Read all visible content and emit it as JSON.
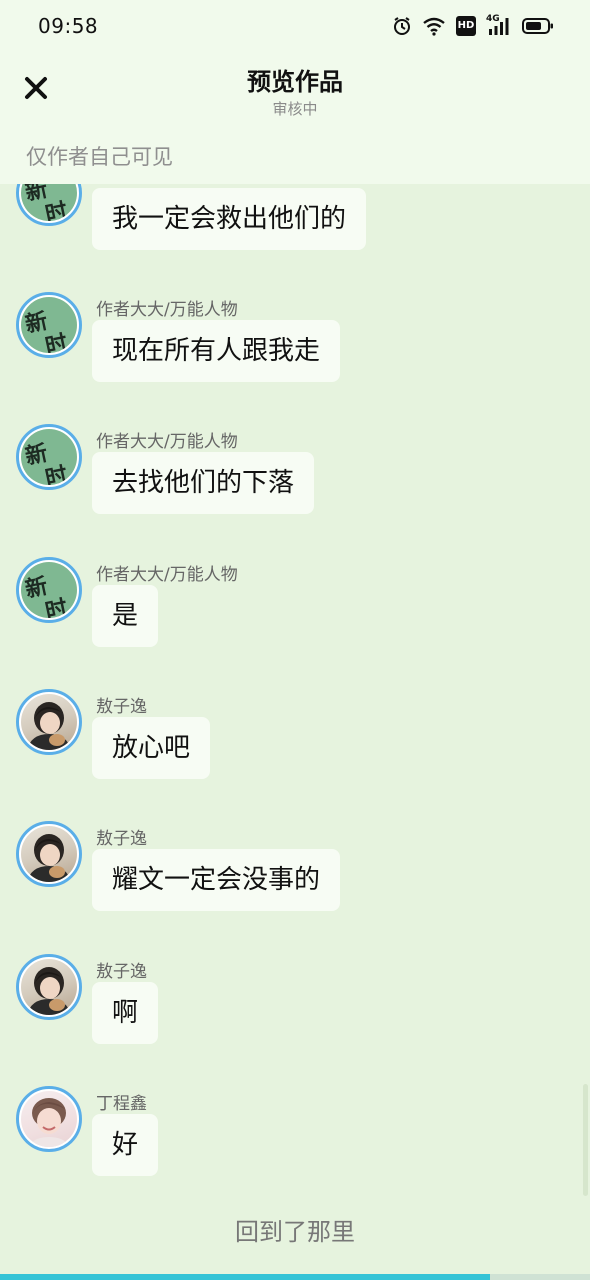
{
  "status_bar": {
    "time": "09:58",
    "icons": [
      "alarm-icon",
      "wifi-icon",
      "hd-icon",
      "signal-4g-icon",
      "battery-icon"
    ],
    "network_label": "4G",
    "hd_label": "HD"
  },
  "nav": {
    "close_icon": "close-icon",
    "title": "预览作品",
    "subtitle": "审核中"
  },
  "visibility_note": "仅作者自己可见",
  "avatar_glyphs": {
    "xinzu_line1": "新",
    "xinzu_line2": "时"
  },
  "messages": [
    {
      "sender": "",
      "avatar": "xinzu",
      "text": "我一定会救出他们的"
    },
    {
      "sender": "作者大大/万能人物",
      "avatar": "xinzu",
      "text": "现在所有人跟我走"
    },
    {
      "sender": "作者大大/万能人物",
      "avatar": "xinzu",
      "text": "去找他们的下落"
    },
    {
      "sender": "作者大大/万能人物",
      "avatar": "xinzu",
      "text": "是"
    },
    {
      "sender": "敖子逸",
      "avatar": "ao",
      "text": "放心吧"
    },
    {
      "sender": "敖子逸",
      "avatar": "ao",
      "text": "耀文一定会没事的"
    },
    {
      "sender": "敖子逸",
      "avatar": "ao",
      "text": "啊"
    },
    {
      "sender": "丁程鑫",
      "avatar": "ding",
      "text": "好"
    }
  ],
  "footer": {
    "text": "回到了那里"
  },
  "reading_progress": 0.83,
  "colors": {
    "background": "#e6f3de",
    "header": "#f1faec",
    "bubble": "#f7fcf4",
    "avatar_ring": "#5aaee8",
    "progress": "#35c3d6"
  }
}
